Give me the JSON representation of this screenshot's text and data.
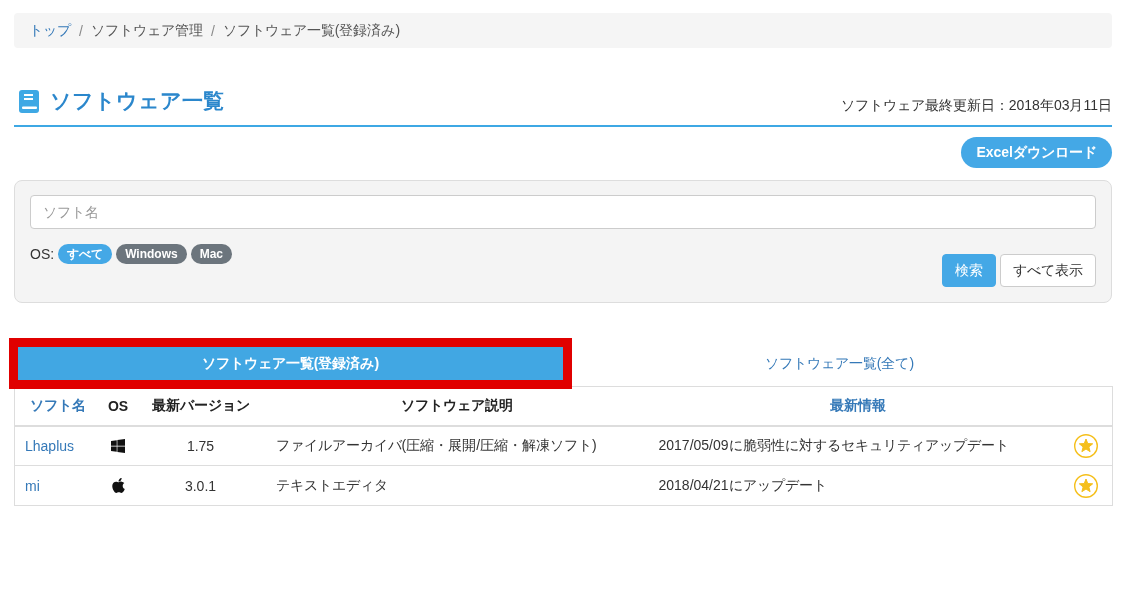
{
  "breadcrumb": {
    "separator": "/",
    "items": [
      {
        "label": "トップ",
        "link": true
      },
      {
        "label": "ソフトウェア管理",
        "link": false
      },
      {
        "label": "ソフトウェア一覧(登録済み)",
        "link": false
      }
    ]
  },
  "page_header": {
    "title": "ソフトウェア一覧",
    "last_updated": "ソフトウェア最終更新日：2018年03月11日"
  },
  "excel_button": "Excelダウンロード",
  "search_panel": {
    "name_field": {
      "placeholder": "ソフト名"
    },
    "os_label": "OS:",
    "os_filters": [
      {
        "label": "すべて",
        "selected": true
      },
      {
        "label": "Windows",
        "selected": false
      },
      {
        "label": "Mac",
        "selected": false
      }
    ],
    "buttons": [
      {
        "label": "検索",
        "kind": "primary"
      },
      {
        "label": "すべて表示",
        "kind": "default"
      }
    ]
  },
  "tabs": [
    {
      "label": "ソフトウェア一覧(登録済み)",
      "selected": true,
      "highlighted": true
    },
    {
      "label": "ソフトウェア一覧(全て)",
      "selected": false,
      "highlighted": false
    }
  ],
  "table": {
    "columns": [
      {
        "label": "ソフト名",
        "link": true
      },
      {
        "label": "OS",
        "link": false
      },
      {
        "label": "最新バージョン",
        "link": false
      },
      {
        "label": "ソフトウェア説明",
        "link": false
      },
      {
        "label": "最新情報",
        "link": true
      }
    ],
    "rows": [
      {
        "name": "Lhaplus",
        "os": {
          "kind": "windows"
        },
        "version": "1.75",
        "description": "ファイルアーカイバ(圧縮・展開/圧縮・解凍ソフト)",
        "latest_info": "2017/05/09に脆弱性に対するセキュリティアップデート",
        "favorite": true
      },
      {
        "name": "mi",
        "os": {
          "kind": "mac"
        },
        "version": "3.0.1",
        "description": "テキストエディタ",
        "latest_info": "2018/04/21にアップデート",
        "favorite": true
      }
    ]
  }
}
